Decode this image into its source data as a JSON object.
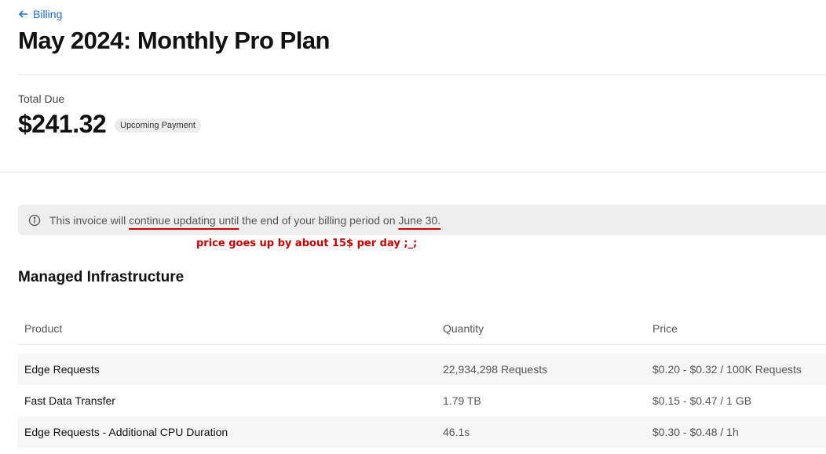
{
  "header": {
    "back_label": "Billing",
    "title": "May 2024: Monthly Pro Plan"
  },
  "summary": {
    "total_label": "Total Due",
    "total_amount": "$241.32",
    "status_badge": "Upcoming Payment"
  },
  "notice": {
    "prefix": "This invoice will ",
    "highlight_1": "continue updating until",
    "middle": " the end of your billing period on ",
    "highlight_2": "June 30."
  },
  "annotation": "price goes up by about 15$ per day ;_;",
  "section": {
    "title": "Managed Infrastructure",
    "columns": [
      "Product",
      "Quantity",
      "Price"
    ],
    "rows": [
      {
        "product": "Edge Requests",
        "quantity": "22,934,298 Requests",
        "price": "$0.20 - $0.32 / 100K Requests"
      },
      {
        "product": "Fast Data Transfer",
        "quantity": "1.79 TB",
        "price": "$0.15 - $0.47 / 1 GB"
      },
      {
        "product": "Edge Requests - Additional CPU Duration",
        "quantity": "46.1s",
        "price": "$0.30 - $0.48 / 1h"
      }
    ]
  },
  "colors": {
    "link": "#1a6fe0",
    "annotation": "#cc0000",
    "badge_bg": "#ececec",
    "notice_bg": "#ededed"
  },
  "icons": [
    "arrow-left-icon",
    "info-icon"
  ]
}
